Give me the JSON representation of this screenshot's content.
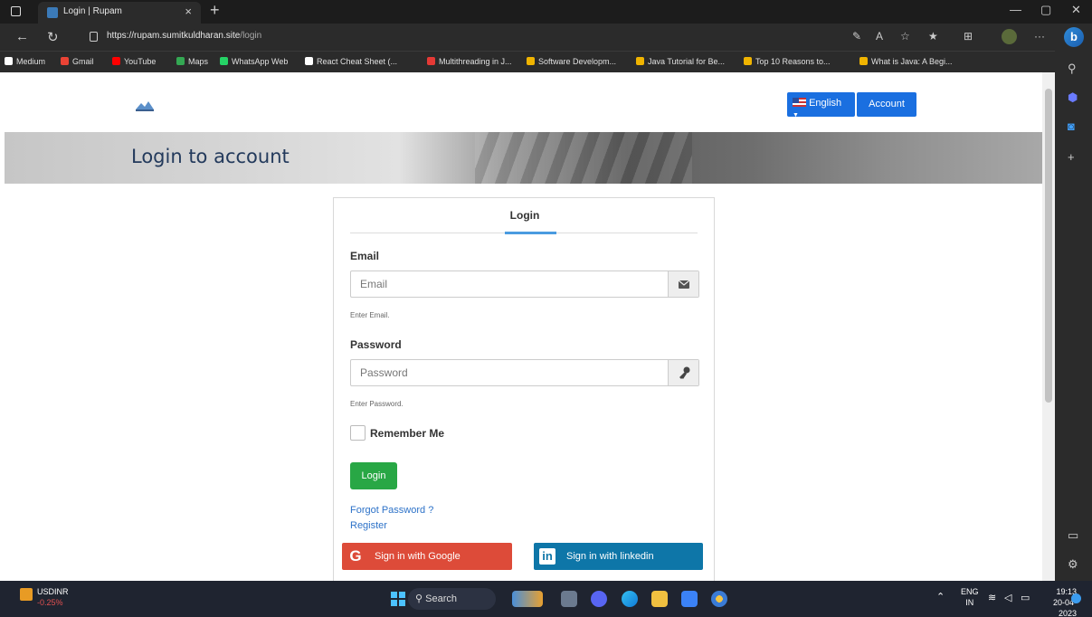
{
  "browser": {
    "tab_title": "Login | Rupam",
    "tab_close": "×",
    "new_tab": "+",
    "url_host": "https://rupam.sumitkuldharan.site",
    "url_path": "/login",
    "win_minimize": "—",
    "win_restore": "▢",
    "win_close": "✕",
    "more_menu": "···"
  },
  "bookmarks": [
    {
      "label": "Medium",
      "color": "#ffffff"
    },
    {
      "label": "Gmail",
      "color": "#ea4335"
    },
    {
      "label": "YouTube",
      "color": "#ff0000"
    },
    {
      "label": "Maps",
      "color": "#34a853"
    },
    {
      "label": "WhatsApp Web",
      "color": "#25d366"
    },
    {
      "label": "React Cheat Sheet (...",
      "color": "#ffffff"
    },
    {
      "label": "Multithreading in J...",
      "color": "#e53935"
    },
    {
      "label": "Software Developm...",
      "color": "#f0b400"
    },
    {
      "label": "Java Tutorial for Be...",
      "color": "#f0b400"
    },
    {
      "label": "Top 10 Reasons to...",
      "color": "#f0b400"
    },
    {
      "label": "What is Java: A Begi...",
      "color": "#f0b400"
    }
  ],
  "header": {
    "language_label": "English",
    "account_label": "Account"
  },
  "hero": {
    "title": "Login to account"
  },
  "login_form": {
    "tab_label": "Login",
    "email_label": "Email",
    "email_placeholder": "Email",
    "email_help": "Enter Email.",
    "password_label": "Password",
    "password_placeholder": "Password",
    "password_help": "Enter Password.",
    "remember_label": "Remember Me",
    "submit_label": "Login",
    "forgot_link": "Forgot Password ?",
    "register_link": "Register",
    "google_label": "Sign in with Google",
    "linkedin_label": "Sign in with linkedin"
  },
  "taskbar": {
    "stock_name": "USDINR",
    "stock_change": "-0.25%",
    "search_label": "Search",
    "language_line1": "ENG",
    "language_line2": "IN",
    "time": "19:13",
    "date": "20-04-2023"
  },
  "colors": {
    "primary_button": "#1a6fe0",
    "success_button": "#28a745",
    "google_red": "#dd4b39",
    "linkedin_blue": "#0e76a8"
  }
}
